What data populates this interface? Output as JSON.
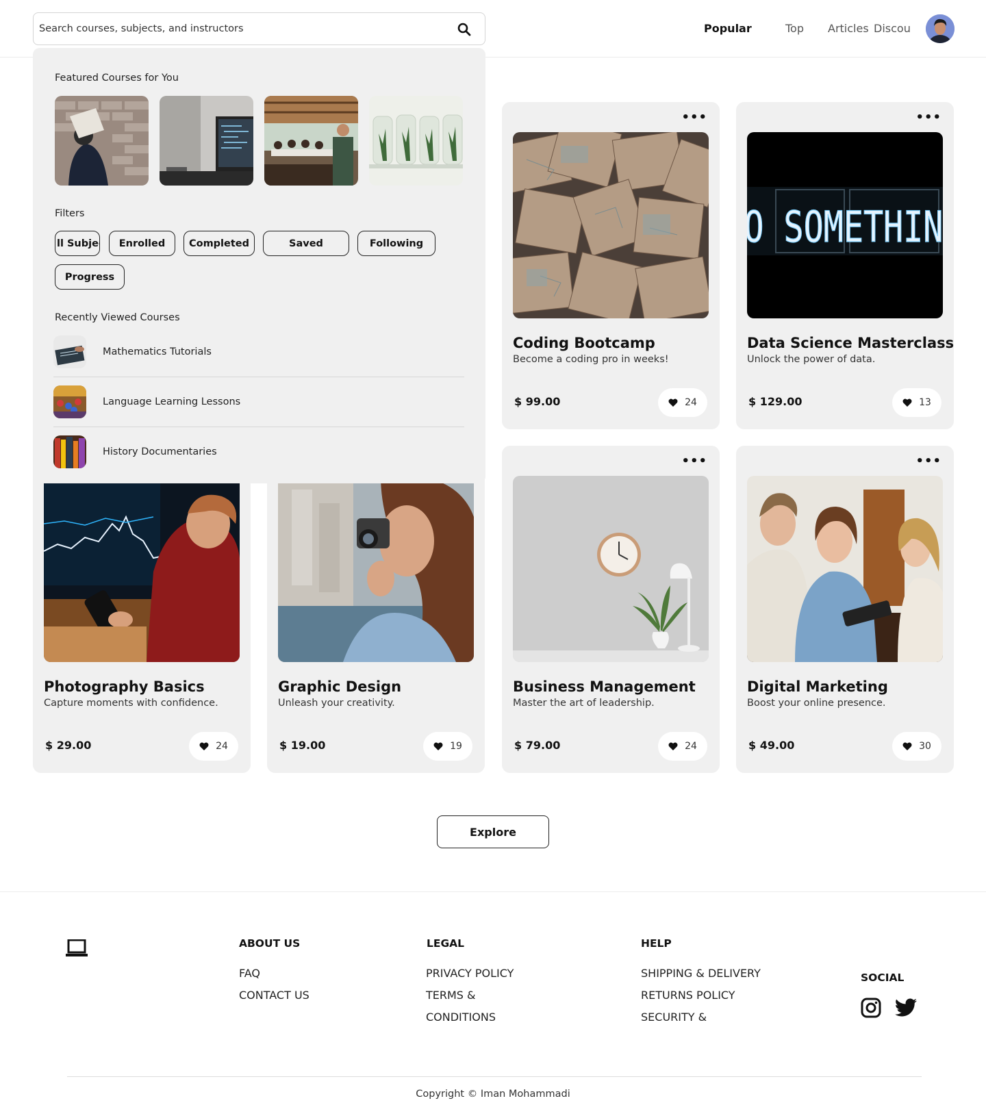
{
  "header": {
    "search_placeholder": "Search courses, subjects, and instructors",
    "nav": [
      "Popular",
      "Top",
      "Articles",
      "Discou"
    ],
    "active_nav": "Popular"
  },
  "dropdown": {
    "featured_title": "Featured Courses for You",
    "filters_title": "Filters",
    "filters": [
      "ll Subject",
      "Enrolled",
      "Completed",
      "Saved",
      "Following",
      "Progress"
    ],
    "recent_title": "Recently Viewed Courses",
    "recent": [
      "Mathematics Tutorials",
      "Language Learning Lessons",
      "History Documentaries"
    ]
  },
  "courses": [
    {
      "title": "Photography Basics",
      "subtitle": "Capture moments with confidence.",
      "price": "29.00",
      "likes": "24"
    },
    {
      "title": "Graphic Design",
      "subtitle": "Unleash your creativity.",
      "price": "19.00",
      "likes": "19"
    },
    {
      "title": "Coding Bootcamp",
      "subtitle": "Become a coding pro in weeks!",
      "price": "99.00",
      "likes": "24"
    },
    {
      "title": "Data Science Masterclass",
      "subtitle": "Unlock the power of data.",
      "price": "129.00",
      "likes": "13"
    },
    {
      "title": "Business Management",
      "subtitle": "Master the art of leadership.",
      "price": "79.00",
      "likes": "24"
    },
    {
      "title": "Digital Marketing",
      "subtitle": "Boost your online presence.",
      "price": "49.00",
      "likes": "30"
    }
  ],
  "currency": "$",
  "neon_text": "O SOMETHING GREA",
  "explore_label": "Explore",
  "footer": {
    "about": {
      "title": "ABOUT US",
      "links": [
        "FAQ",
        "CONTACT US"
      ]
    },
    "legal": {
      "title": "LEGAL",
      "links": [
        "PRIVACY POLICY",
        "TERMS &",
        "CONDITIONS"
      ]
    },
    "help": {
      "title": "HELP",
      "links": [
        "SHIPPING & DELIVERY",
        "RETURNS POLICY",
        "SECURITY &"
      ]
    },
    "social": {
      "title": "SOCIAL",
      "icons": [
        "instagram-icon",
        "twitter-icon"
      ]
    },
    "copyright": "Copyright © Iman Mohammadi"
  },
  "colors": {
    "card_bg": "#f0f0f0",
    "text": "#111111",
    "accent": "#111111"
  }
}
